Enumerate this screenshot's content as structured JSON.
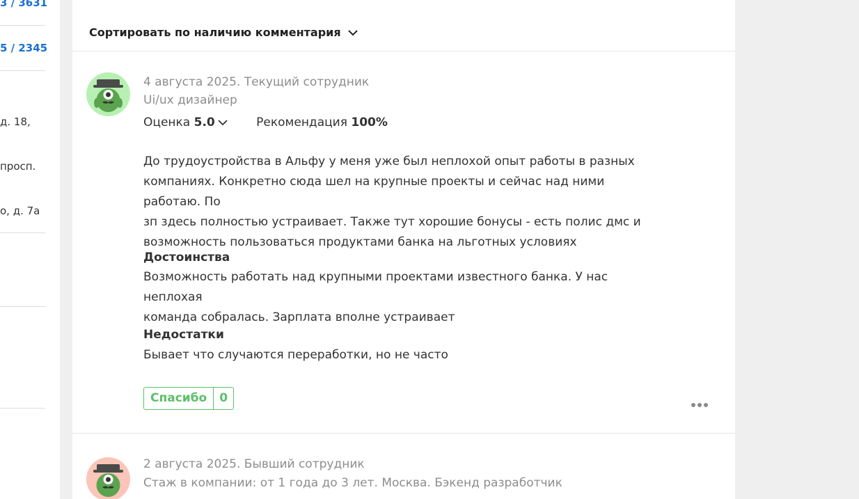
{
  "left_column": {
    "link1": "3 / 3631",
    "link2": "5 / 2345",
    "addr1": "д. 18,",
    "addr2": "просп.",
    "addr3": "о, д. 7а"
  },
  "sort": {
    "label": "Сортировать по наличию комментария"
  },
  "reviews": [
    {
      "meta_line1": "4 августа 2025. Текущий сотрудник",
      "meta_line2": "Ui/ux дизайнер",
      "rating_label": "Оценка",
      "rating_value": "5.0",
      "recommend_label": "Рекомендация",
      "recommend_value": "100%",
      "text_lines": [
        "До трудоустройства в Альфу у меня уже был неплохой опыт работы в разных",
        "компаниях. Конкретно сюда шел на крупные проекты и сейчас над ними работаю. По",
        "зп здесь полностью устраивает. Также тут хорошие бонусы - есть полис дмс и",
        "возможность пользоваться продуктами банка на льготных условиях"
      ],
      "pros_title": "Достоинства",
      "pros_lines": [
        "Возможность работать над крупными проектами известного банка. У нас неплохая",
        "команда собралась. Зарплата вполне устраивает"
      ],
      "cons_title": "Недостатки",
      "cons_lines": [
        "Бывает что случаются переработки, но не часто"
      ],
      "thanks_label": "Спасибо",
      "thanks_count": "0"
    },
    {
      "meta_line1": "2 августа 2025. Бывший сотрудник",
      "meta_line2": "Стаж в компании: от 1 года до 3 лет. Москва. Бэкенд разработчик"
    }
  ],
  "icons": {
    "sort_chevron": "chevron-down-icon",
    "rating_chevron": "chevron-down-icon",
    "more": "more-dots-icon",
    "avatar": "monster-avatar-icon"
  },
  "colors": {
    "link": "#1a6fd1",
    "thanks_green": "#5cc06a",
    "avatar1_bg": "#b8f0b4",
    "avatar2_bg": "#fbc5b9",
    "meta_gray": "#8d8d8d"
  }
}
